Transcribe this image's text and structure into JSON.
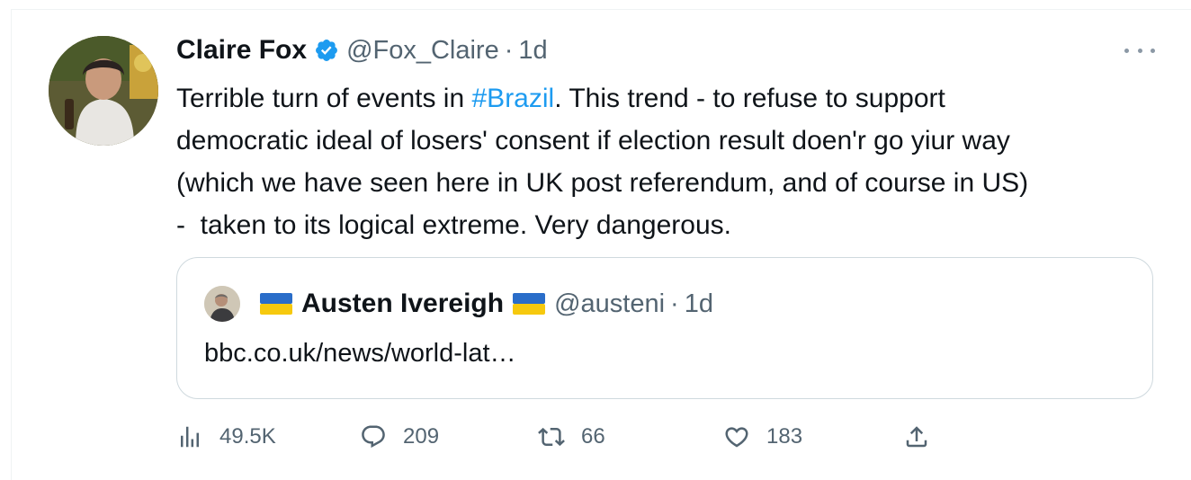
{
  "tweet": {
    "author_name": "Claire Fox",
    "author_handle": "@Fox_Claire",
    "separator": "·",
    "time": "1d",
    "text_lines": [
      {
        "before": "Terrible turn of events in ",
        "hashtag": "#Brazil",
        "after": ". This trend - to refuse to support"
      },
      {
        "text": "democratic ideal of losers' consent if election result doen'r go yiur way"
      },
      {
        "text": "(which we have seen here in UK post referendum, and of course in US)"
      },
      {
        "text": "-  taken to its logical extreme. Very dangerous."
      }
    ],
    "icons": {
      "verified": "verified-badge-icon",
      "more": "more-options-icon"
    }
  },
  "quoted_tweet": {
    "author_name": "Austen Ivereigh",
    "author_handle": "@austeni",
    "separator": "·",
    "time": "1d",
    "text": "bbc.co.uk/news/world-lat…",
    "flag_icon": "ukraine-flag-icon"
  },
  "actions": {
    "views": {
      "icon": "views-chart-icon",
      "count": "49.5K"
    },
    "replies": {
      "icon": "reply-bubble-icon",
      "count": "209"
    },
    "retweets": {
      "icon": "retweet-icon",
      "count": "66"
    },
    "likes": {
      "icon": "heart-icon",
      "count": "183"
    },
    "share": {
      "icon": "share-upload-icon"
    }
  },
  "colors": {
    "accent": "#1d9bf0",
    "text_primary": "#0f1419",
    "text_secondary": "#536471",
    "border": "#cfd9de"
  }
}
